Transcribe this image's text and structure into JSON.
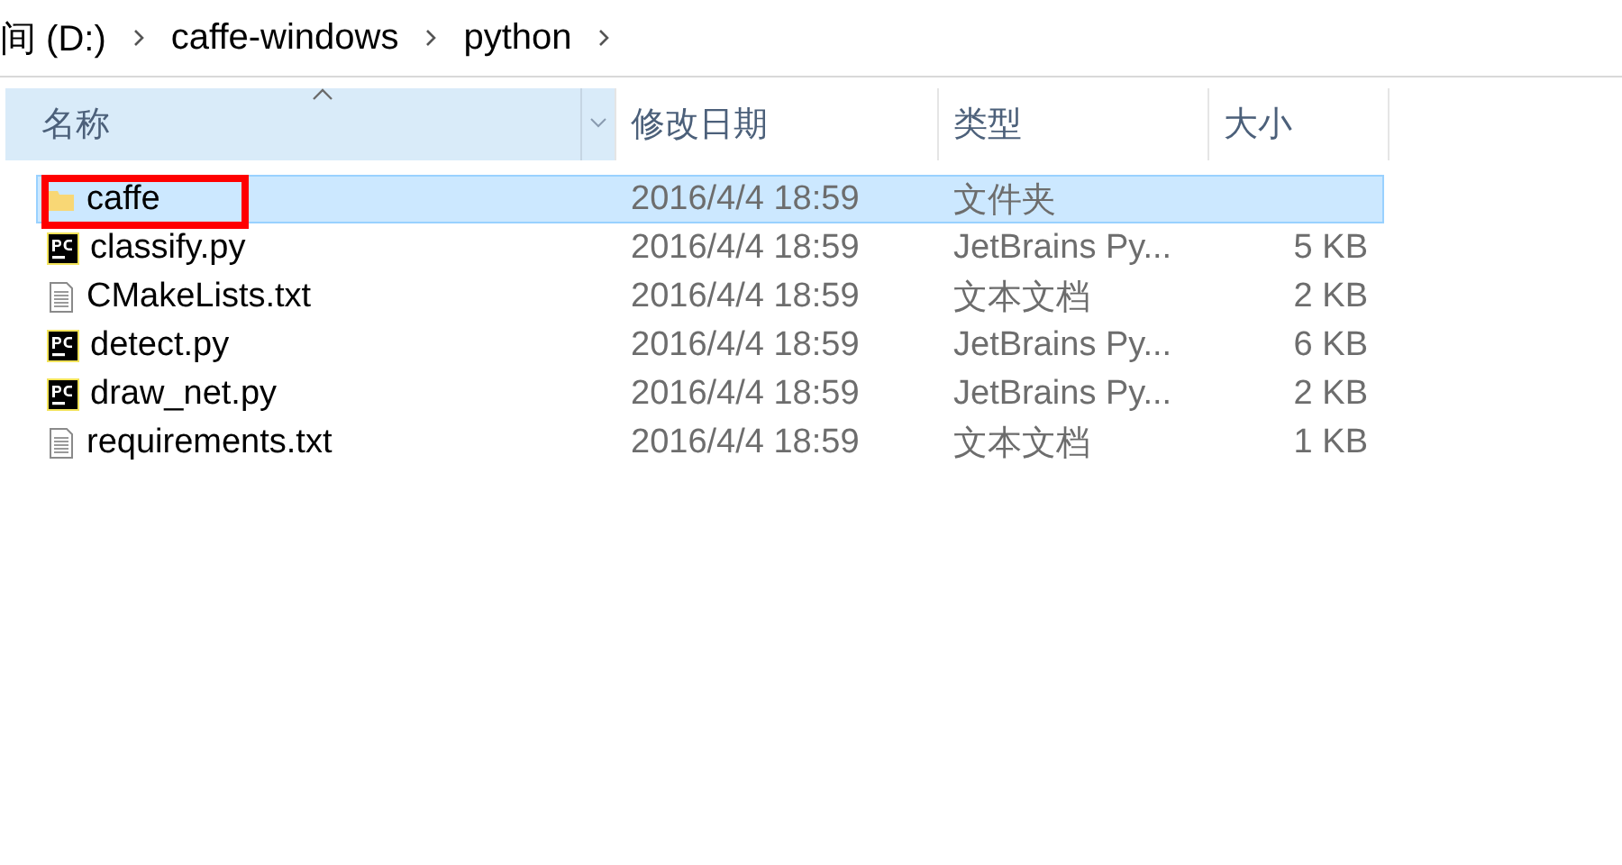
{
  "breadcrumb": [
    "间 (D:)",
    "caffe-windows",
    "python"
  ],
  "table": {
    "columns": [
      {
        "label": "名称",
        "sorted": true,
        "hovered": true
      },
      {
        "label": "修改日期",
        "sorted": false,
        "hovered": false
      },
      {
        "label": "类型",
        "sorted": false,
        "hovered": false
      },
      {
        "label": "大小",
        "sorted": false,
        "hovered": false
      }
    ],
    "rows": [
      {
        "kind": "folder",
        "name": "caffe",
        "modified": "2016/4/4 18:59",
        "type": "文件夹",
        "size": "",
        "selected": true,
        "annotated": true
      },
      {
        "kind": "pycharm",
        "name": "classify.py",
        "modified": "2016/4/4 18:59",
        "type": "JetBrains Py...",
        "size": "5 KB",
        "selected": false,
        "annotated": false
      },
      {
        "kind": "text",
        "name": "CMakeLists.txt",
        "modified": "2016/4/4 18:59",
        "type": "文本文档",
        "size": "2 KB",
        "selected": false,
        "annotated": false
      },
      {
        "kind": "pycharm",
        "name": "detect.py",
        "modified": "2016/4/4 18:59",
        "type": "JetBrains Py...",
        "size": "6 KB",
        "selected": false,
        "annotated": false
      },
      {
        "kind": "pycharm",
        "name": "draw_net.py",
        "modified": "2016/4/4 18:59",
        "type": "JetBrains Py...",
        "size": "2 KB",
        "selected": false,
        "annotated": false
      },
      {
        "kind": "text",
        "name": "requirements.txt",
        "modified": "2016/4/4 18:59",
        "type": "文本文档",
        "size": "1 KB",
        "selected": false,
        "annotated": false
      }
    ]
  }
}
